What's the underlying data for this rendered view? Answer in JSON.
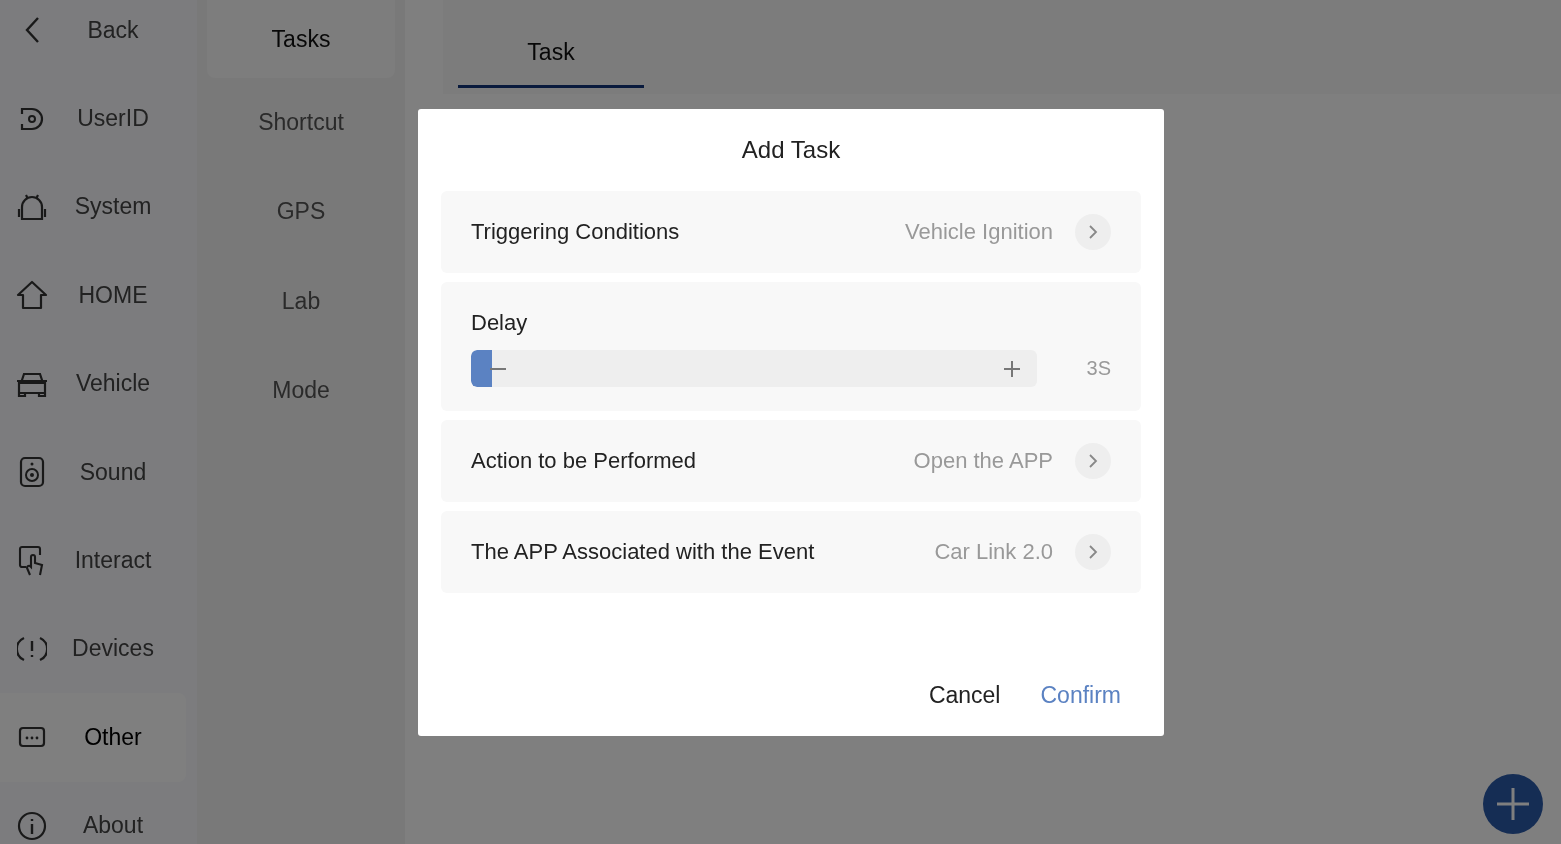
{
  "sidebar": {
    "items": [
      {
        "label": "Back",
        "selected": false
      },
      {
        "label": "UserID",
        "selected": false
      },
      {
        "label": "System",
        "selected": false
      },
      {
        "label": "HOME",
        "selected": false
      },
      {
        "label": "Vehicle",
        "selected": false
      },
      {
        "label": "Sound",
        "selected": false
      },
      {
        "label": "Interact",
        "selected": false
      },
      {
        "label": "Devices",
        "selected": false
      },
      {
        "label": "Other",
        "selected": true
      },
      {
        "label": "About",
        "selected": false
      }
    ]
  },
  "subnav": {
    "items": [
      {
        "label": "Tasks",
        "selected": true
      },
      {
        "label": "Shortcut",
        "selected": false
      },
      {
        "label": "GPS",
        "selected": false
      },
      {
        "label": "Lab",
        "selected": false
      },
      {
        "label": "Mode",
        "selected": false
      }
    ]
  },
  "tabs": [
    {
      "label": "Task",
      "selected": true
    }
  ],
  "dialog": {
    "title": "Add Task",
    "rows": [
      {
        "kind": "select",
        "label": "Triggering Conditions",
        "value": "Vehicle Ignition"
      },
      {
        "kind": "slider",
        "label": "Delay",
        "level": 0.02,
        "reading": "3S"
      },
      {
        "kind": "select",
        "label": "Action to be Performed",
        "value": "Open the APP"
      },
      {
        "kind": "select",
        "label": "The APP Associated with the Event",
        "value": "Car Link 2.0"
      }
    ],
    "buttons": [
      {
        "label": "Cancel",
        "kind": "secondary"
      },
      {
        "label": "Confirm",
        "kind": "primary"
      }
    ]
  }
}
